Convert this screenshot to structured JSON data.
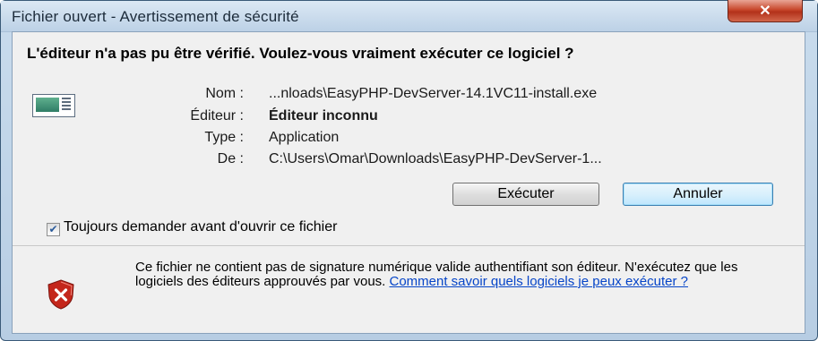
{
  "window": {
    "title": "Fichier ouvert - Avertissement de sécurité",
    "close_glyph": "✕"
  },
  "dialog": {
    "question": "L'éditeur n'a pas pu être vérifié. Voulez-vous vraiment exécuter ce logiciel ?",
    "icon": "application-file-icon",
    "fields": [
      {
        "label": "Nom :",
        "value": "...nloads\\EasyPHP-DevServer-14.1VC11-install.exe"
      },
      {
        "label": "Éditeur :",
        "value": "Éditeur inconnu"
      },
      {
        "label": "Type :",
        "value": "Application"
      },
      {
        "label": "De :",
        "value": "C:\\Users\\Omar\\Downloads\\EasyPHP-DevServer-1..."
      }
    ],
    "buttons": {
      "run": "Exécuter",
      "cancel": "Annuler"
    },
    "always_ask": {
      "checked": true,
      "check_glyph": "✔",
      "label": "Toujours demander avant d'ouvrir ce fichier"
    },
    "warning": {
      "icon": "shield-error-icon",
      "text": "Ce fichier ne contient pas de signature numérique valide authentifiant son éditeur. N'exécutez que les logiciels des éditeurs approuvés par vous. ",
      "link": "Comment savoir quels logiciels je peux exécuter ?"
    }
  },
  "colors": {
    "link": "#0645c8",
    "shield": "#c4261b"
  }
}
